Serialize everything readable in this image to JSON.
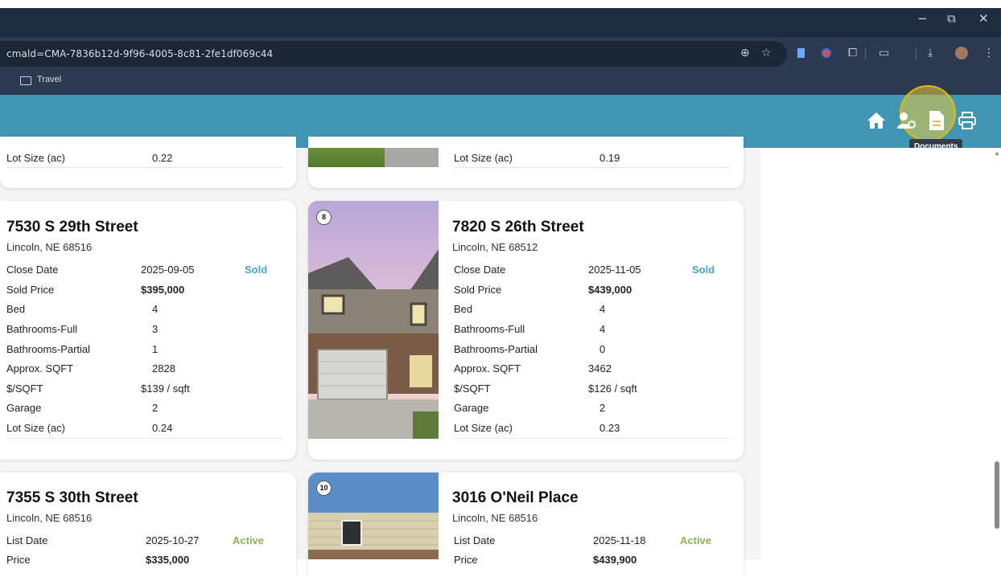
{
  "browser": {
    "url": "cmald=CMA-7836b12d-9f96-4005-8c81-2fe1df069c44",
    "bookmark_folder": "Travel",
    "window_controls": {
      "minimize": "−",
      "restore": "⧉",
      "close": "✕"
    }
  },
  "header": {
    "icons": [
      "home-icon",
      "users-icon",
      "documents-icon",
      "print-icon"
    ],
    "tooltip": "Documents",
    "highlight_color": "#e8b800",
    "bg_color": "#4196b6"
  },
  "top_cards": {
    "left": {
      "label": "Lot Size (ac)",
      "value": "0.22"
    },
    "right": {
      "label": "Lot Size (ac)",
      "value": "0.19"
    }
  },
  "listings": [
    {
      "address": "7530 S 29th Street",
      "city": "Lincoln, NE 68516",
      "date_label": "Close Date",
      "date": "2025-09-05",
      "status": "Sold",
      "price_label": "Sold Price",
      "price": "$395,000",
      "rows": [
        {
          "label": "Bed",
          "value": "4"
        },
        {
          "label": "Bathrooms-Full",
          "value": "3"
        },
        {
          "label": "Bathrooms-Partial",
          "value": "1"
        },
        {
          "label": "Approx. SQFT",
          "value": "2828"
        },
        {
          "label": "$/SQFT",
          "value": "$139 / sqft"
        },
        {
          "label": "Garage",
          "value": "2"
        },
        {
          "label": "Lot Size (ac)",
          "value": "0.24"
        }
      ]
    },
    {
      "number": "8",
      "address": "7820 S 26th Street",
      "city": "Lincoln, NE 68512",
      "date_label": "Close Date",
      "date": "2025-11-05",
      "status": "Sold",
      "price_label": "Sold Price",
      "price": "$439,000",
      "rows": [
        {
          "label": "Bed",
          "value": "4"
        },
        {
          "label": "Bathrooms-Full",
          "value": "4"
        },
        {
          "label": "Bathrooms-Partial",
          "value": "0"
        },
        {
          "label": "Approx. SQFT",
          "value": "3462"
        },
        {
          "label": "$/SQFT",
          "value": "$126 / sqft"
        },
        {
          "label": "Garage",
          "value": "2"
        },
        {
          "label": "Lot Size (ac)",
          "value": "0.23"
        }
      ]
    },
    {
      "address": "7355 S 30th Street",
      "city": "Lincoln, NE 68516",
      "date_label": "List Date",
      "date": "2025-10-27",
      "status": "Active",
      "price_label": "Price",
      "price": "$335,000"
    },
    {
      "number": "10",
      "address": "3016 O'Neil Place",
      "city": "Lincoln, NE 68516",
      "date_label": "List Date",
      "date": "2025-11-18",
      "status": "Active",
      "price_label": "Price",
      "price": "$439,900"
    }
  ]
}
